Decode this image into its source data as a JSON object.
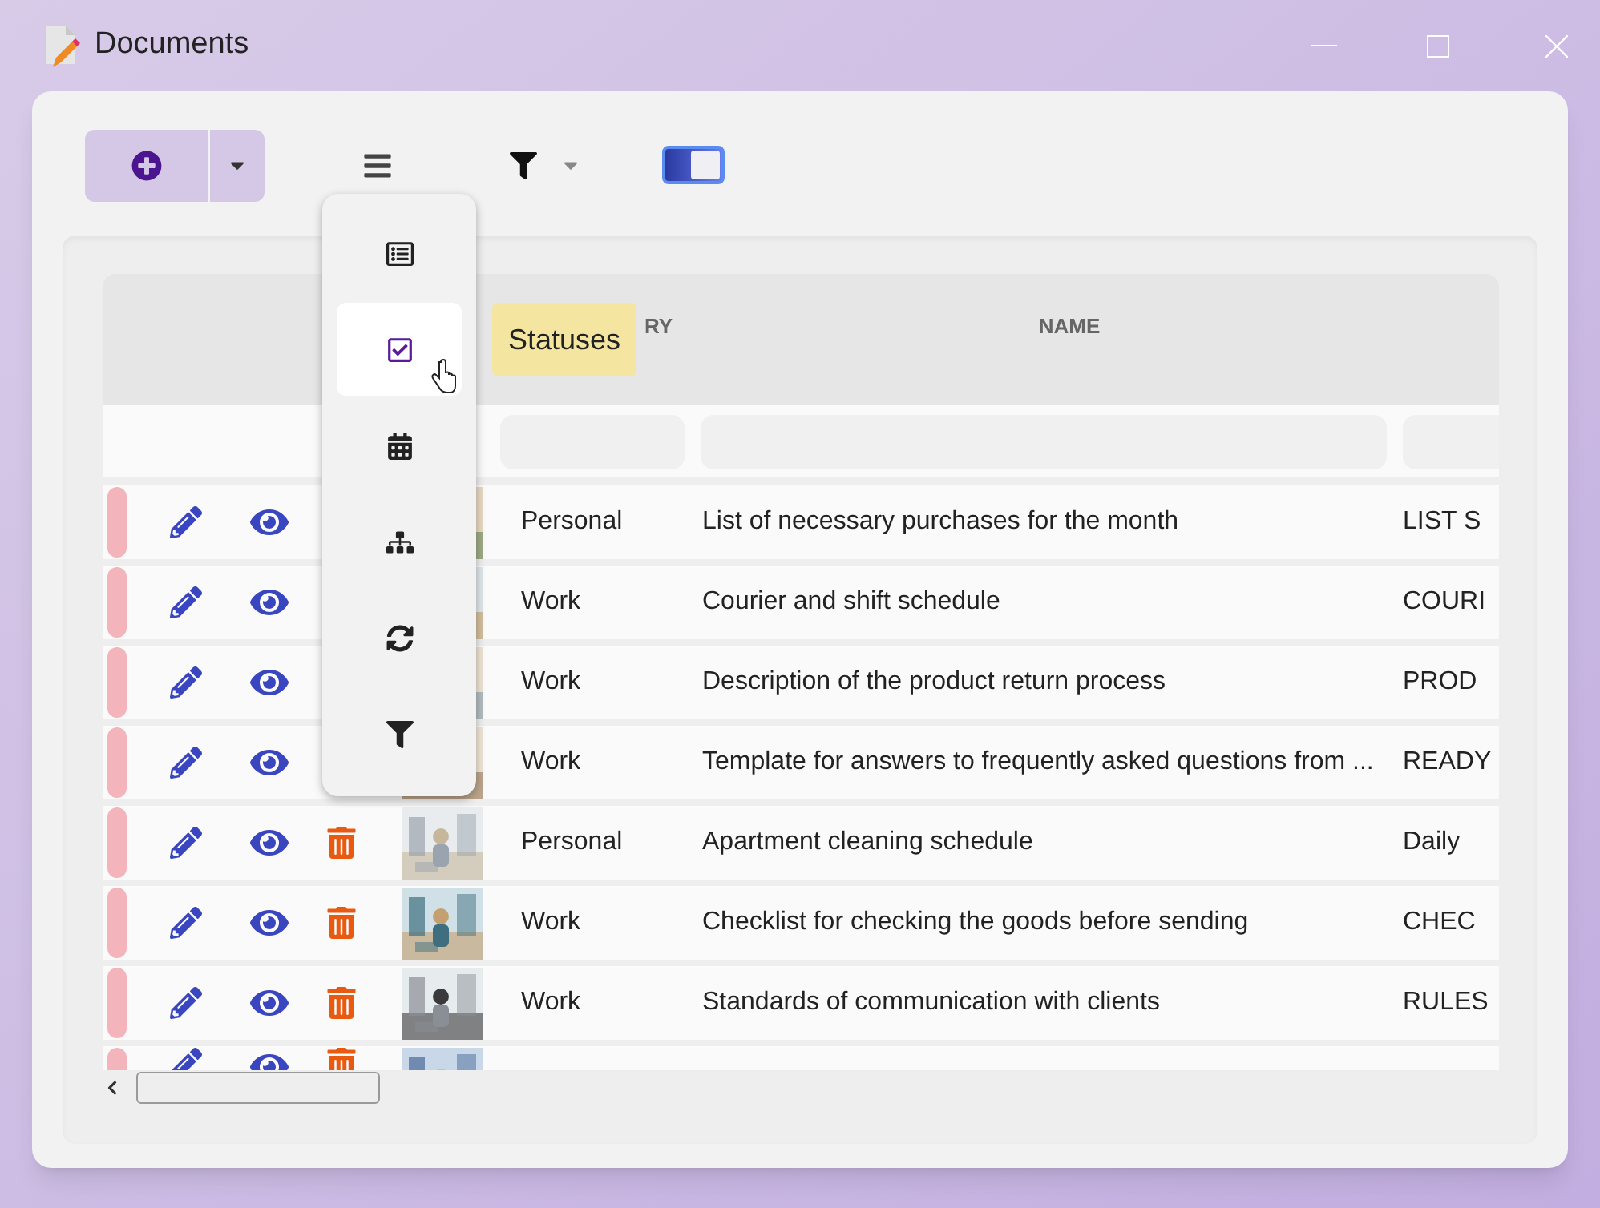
{
  "window": {
    "title": "Documents"
  },
  "toolbar": {
    "view_toggle": {
      "on": true
    }
  },
  "view_menu": {
    "items": [
      {
        "selected": false
      },
      {
        "selected": true
      },
      {
        "selected": false
      },
      {
        "selected": false
      },
      {
        "selected": false
      },
      {
        "selected": false
      }
    ]
  },
  "tooltip": "Statuses",
  "table": {
    "columns": [
      "RY",
      "NAME"
    ],
    "rows": [
      {
        "category": "Personal",
        "name": "List of necessary purchases for the month",
        "column_3": "LIST S",
        "color": "#f4b4bb"
      },
      {
        "category": "Work",
        "name": "Courier and shift schedule",
        "column_3": "COURI",
        "color": "#f4b4bb"
      },
      {
        "category": "Work",
        "name": "Description of the product return process",
        "column_3": "PROD",
        "color": "#f4b4bb"
      },
      {
        "category": "Work",
        "name": "Template for answers to frequently asked questions from ...",
        "column_3": "READY",
        "color": "#f4b4bb"
      },
      {
        "category": "Personal",
        "name": "Apartment cleaning schedule",
        "column_3": "Daily",
        "color": "#f4b4bb"
      },
      {
        "category": "Work",
        "name": "Checklist for checking the goods before sending",
        "column_3": "CHEC",
        "color": "#f4b4bb"
      },
      {
        "category": "Work",
        "name": "Standards of communication with clients",
        "column_3": "RULES",
        "color": "#f4b4bb"
      }
    ]
  }
}
